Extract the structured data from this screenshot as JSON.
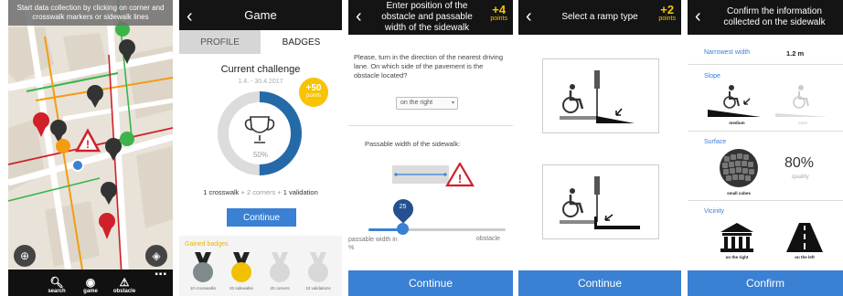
{
  "screen1": {
    "banner": "Start data collection by clicking on corner and crosswalk markers or sidewalk lines",
    "nav": [
      {
        "label": "search",
        "icon": "search-icon"
      },
      {
        "label": "game",
        "icon": "gamepad-icon"
      },
      {
        "label": "obstacle",
        "icon": "warning-icon"
      }
    ],
    "menu_dots": "▪▪▪"
  },
  "screen2": {
    "title": "Game",
    "tabs": {
      "profile": "PROFILE",
      "badges": "BADGES"
    },
    "challenge_title": "Current challenge",
    "challenge_dates": "1.4. - 30.4.2017",
    "points_value": "+50",
    "points_label": "points",
    "progress_percent": 50,
    "progress_text": "50%",
    "progress_line": {
      "a": "1 crosswalk",
      "b": " + 2 corners + ",
      "c": "1 validation"
    },
    "continue": "Continue",
    "gained_label": "Gained badges",
    "badges": [
      {
        "caption": "10 crosswalks",
        "color": "#808a8a",
        "earned": true
      },
      {
        "caption": "20 sidewalks",
        "color": "#f1c100",
        "earned": true
      },
      {
        "caption": "20 corners",
        "color": "#d8d8d8",
        "earned": false
      },
      {
        "caption": "10 validations",
        "color": "#d8d8d8",
        "earned": false
      }
    ]
  },
  "screen3": {
    "title": "Enter position of the obstacle and passable width of the sidewalk",
    "points_value": "+4",
    "points_label": "points",
    "question": "Please, turn in the direction of the nearest driving lane. On which side of the pavement is the obstacle located?",
    "side_value": "on the right",
    "width_label": "Passable width of the sidewalk:",
    "slider_value": "25",
    "slider_fraction": 0.25,
    "slider_min": "passable width in %",
    "slider_max": "obstacle",
    "continue": "Continue"
  },
  "screen4": {
    "title": "Select a ramp type",
    "points_value": "+2",
    "points_label": "points",
    "continue": "Continue"
  },
  "screen5": {
    "title": "Confirm the information collected on the sidewalk",
    "narrowest_label": "Narrowest width",
    "narrowest_value": "1.2 m",
    "slope_label": "Slope",
    "slope_medium": "medium",
    "slope_none": "none",
    "surface_label": "Surface",
    "surface_caption": "small cubes",
    "quality_value": "80%",
    "quality_label": "quality",
    "vicinity_label": "Vicinity",
    "vicinity_right": "on the right",
    "vicinity_left": "on the left",
    "confirm": "Confirm"
  },
  "colors": {
    "accent": "#3a80d3",
    "gold": "#f7c400",
    "header": "#141414",
    "warning": "#d0202a"
  }
}
